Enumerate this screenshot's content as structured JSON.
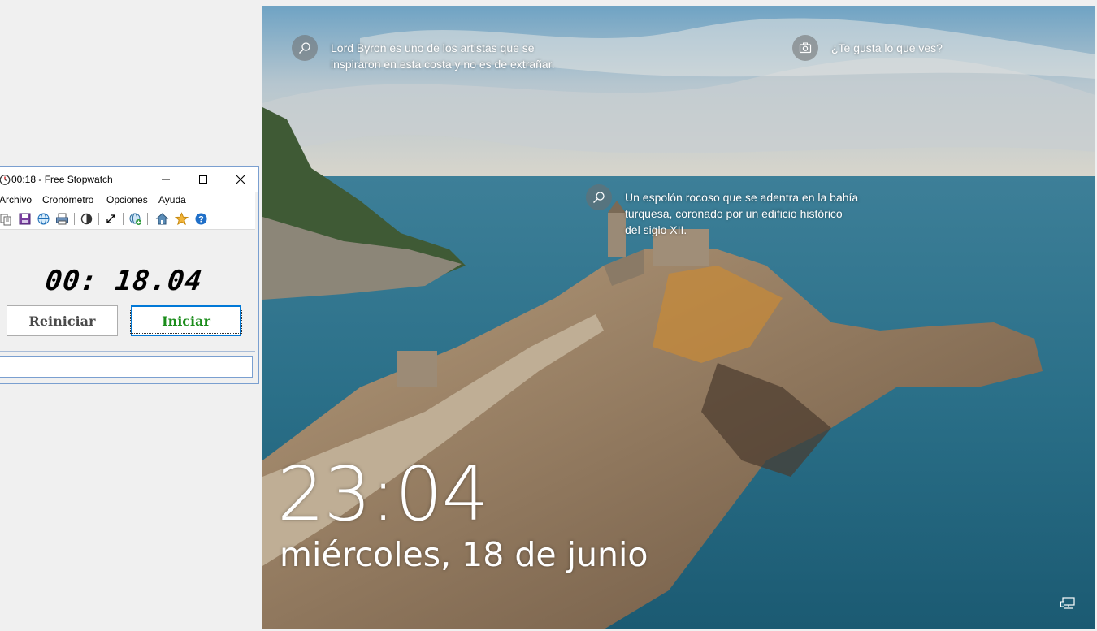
{
  "stopwatch": {
    "title": "00:18 - Free Stopwatch",
    "menu": [
      "Archivo",
      "Cronómetro",
      "Opciones",
      "Ayuda"
    ],
    "toolbar_icons": [
      "copy-icon",
      "save-icon",
      "globe-icon",
      "print-icon",
      "contrast-icon",
      "fullscreen-icon",
      "add-web-icon",
      "home-icon",
      "star-icon",
      "help-icon"
    ],
    "time": "00: 18.04",
    "reset_label": "Reiniciar",
    "start_label": "Iniciar",
    "start_color": "#1a8c1a"
  },
  "lockscreen": {
    "spotlight_left": "Lord Byron es uno de los artistas que se inspiraron en esta costa y no es de extrañar.",
    "spotlight_like": "¿Te gusta lo que ves?",
    "spotlight_center": "Un espolón rocoso que se adentra en la bahía turquesa, coronado por un edificio histórico del siglo XII.",
    "clock": "23:04",
    "date": "miércoles, 18 de junio"
  }
}
